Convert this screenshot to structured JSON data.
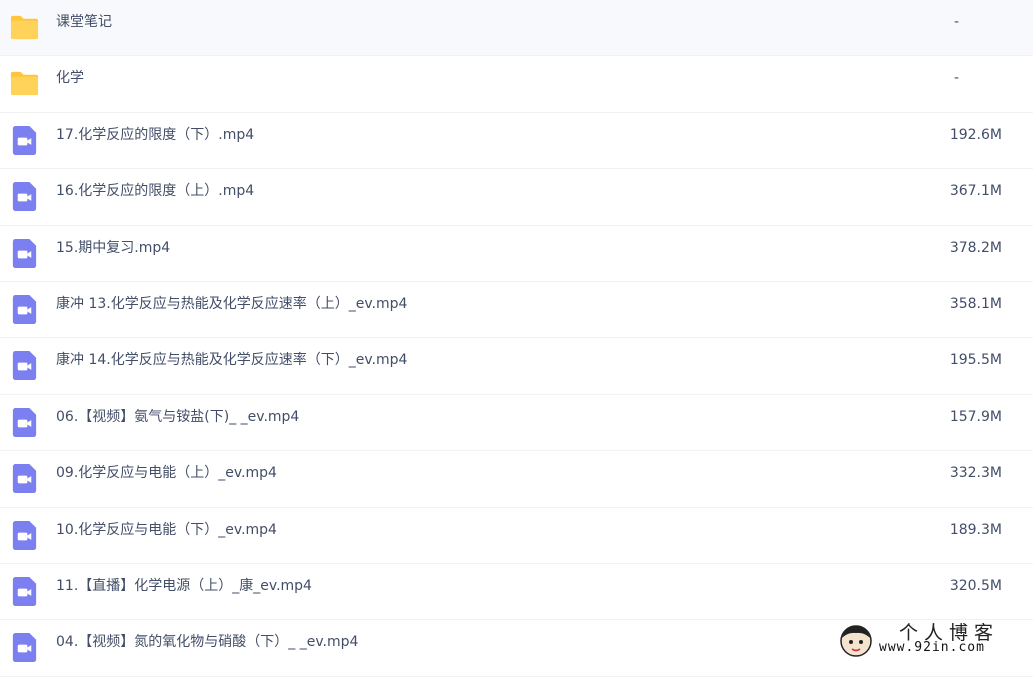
{
  "colors": {
    "folder_icon": "#ffd35a",
    "folder_tab": "#ffc53d",
    "video_icon": "#7b7ff0",
    "text": "#424e67",
    "row_divider": "#f1f2f4"
  },
  "files": [
    {
      "type": "folder",
      "icon": "folder-icon",
      "name": "课堂笔记",
      "size": "-"
    },
    {
      "type": "folder",
      "icon": "folder-icon",
      "name": "化学",
      "size": "-"
    },
    {
      "type": "video",
      "icon": "video-file-icon",
      "name": "17.化学反应的限度（下）.mp4",
      "size": "192.6M"
    },
    {
      "type": "video",
      "icon": "video-file-icon",
      "name": "16.化学反应的限度（上）.mp4",
      "size": "367.1M"
    },
    {
      "type": "video",
      "icon": "video-file-icon",
      "name": "15.期中复习.mp4",
      "size": "378.2M"
    },
    {
      "type": "video",
      "icon": "video-file-icon",
      "name": "康冲 13.化学反应与热能及化学反应速率（上）_ev.mp4",
      "size": "358.1M"
    },
    {
      "type": "video",
      "icon": "video-file-icon",
      "name": "康冲 14.化学反应与热能及化学反应速率（下）_ev.mp4",
      "size": "195.5M"
    },
    {
      "type": "video",
      "icon": "video-file-icon",
      "name": "06.【视频】氨气与铵盐(下)_ _ev.mp4",
      "size": "157.9M"
    },
    {
      "type": "video",
      "icon": "video-file-icon",
      "name": "09.化学反应与电能（上）_ev.mp4",
      "size": "332.3M"
    },
    {
      "type": "video",
      "icon": "video-file-icon",
      "name": "10.化学反应与电能（下）_ev.mp4",
      "size": "189.3M"
    },
    {
      "type": "video",
      "icon": "video-file-icon",
      "name": "11.【直播】化学电源（上）_康_ev.mp4",
      "size": "320.5M"
    },
    {
      "type": "video",
      "icon": "video-file-icon",
      "name": "04.【视频】氮的氧化物与硝酸（下）_ _ev.mp4",
      "size": ""
    }
  ],
  "watermark": {
    "title": "个人博客",
    "url": "www.92in.com"
  }
}
